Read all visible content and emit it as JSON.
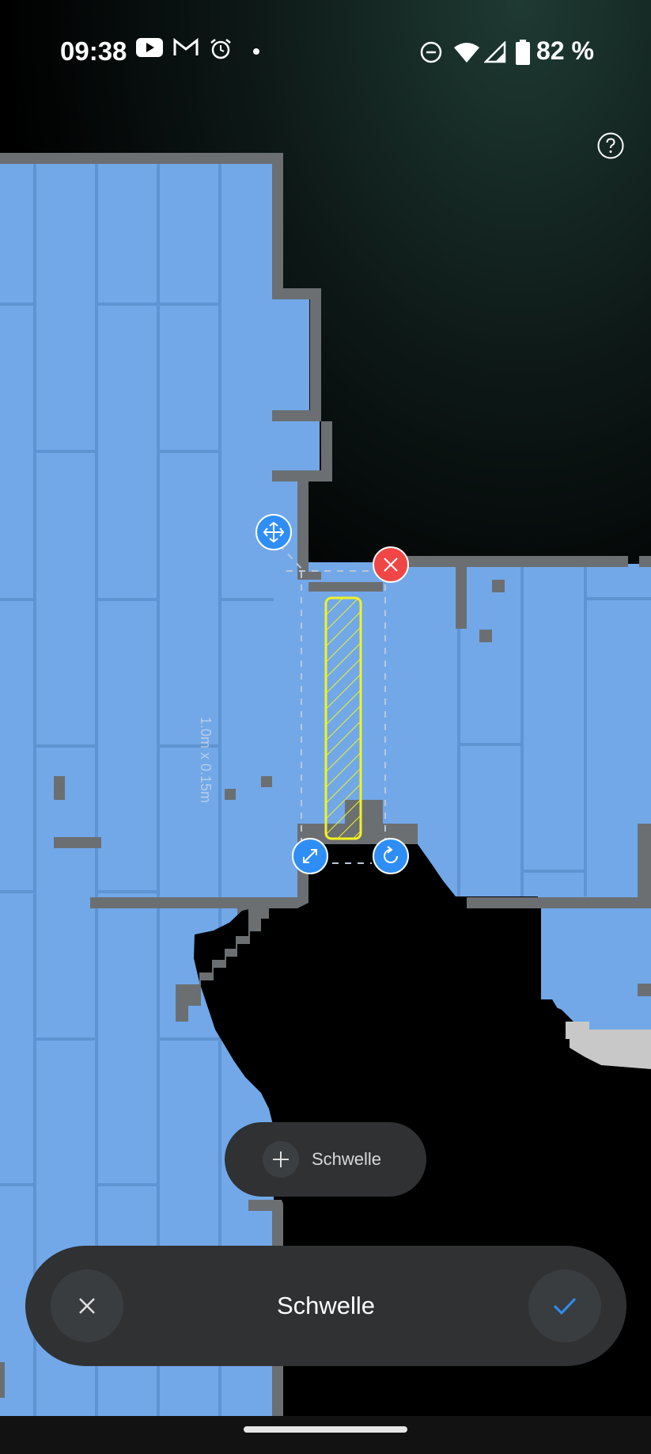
{
  "status_bar": {
    "time": "09:38",
    "battery": "82 %",
    "icons": [
      "youtube-icon",
      "gmail-icon",
      "alarm-icon",
      "dot-icon",
      "dnd-icon",
      "wifi-icon",
      "cellular-icon",
      "battery-icon"
    ]
  },
  "help": {
    "icon": "help-icon"
  },
  "map": {
    "zone_dimensions": "1.0m x 0.15m",
    "floor_color": "#72a8e8",
    "wall_color": "#6b6f72",
    "zone_color": "#f2f224",
    "handles": {
      "move": "move-icon",
      "delete": "delete-icon",
      "resize": "resize-icon",
      "rotate": "rotate-icon"
    }
  },
  "add_button": {
    "label": "Schwelle"
  },
  "bottom_bar": {
    "title": "Schwelle",
    "cancel_icon": "close-icon",
    "confirm_icon": "check-icon",
    "accent": "#2f8ef5"
  }
}
